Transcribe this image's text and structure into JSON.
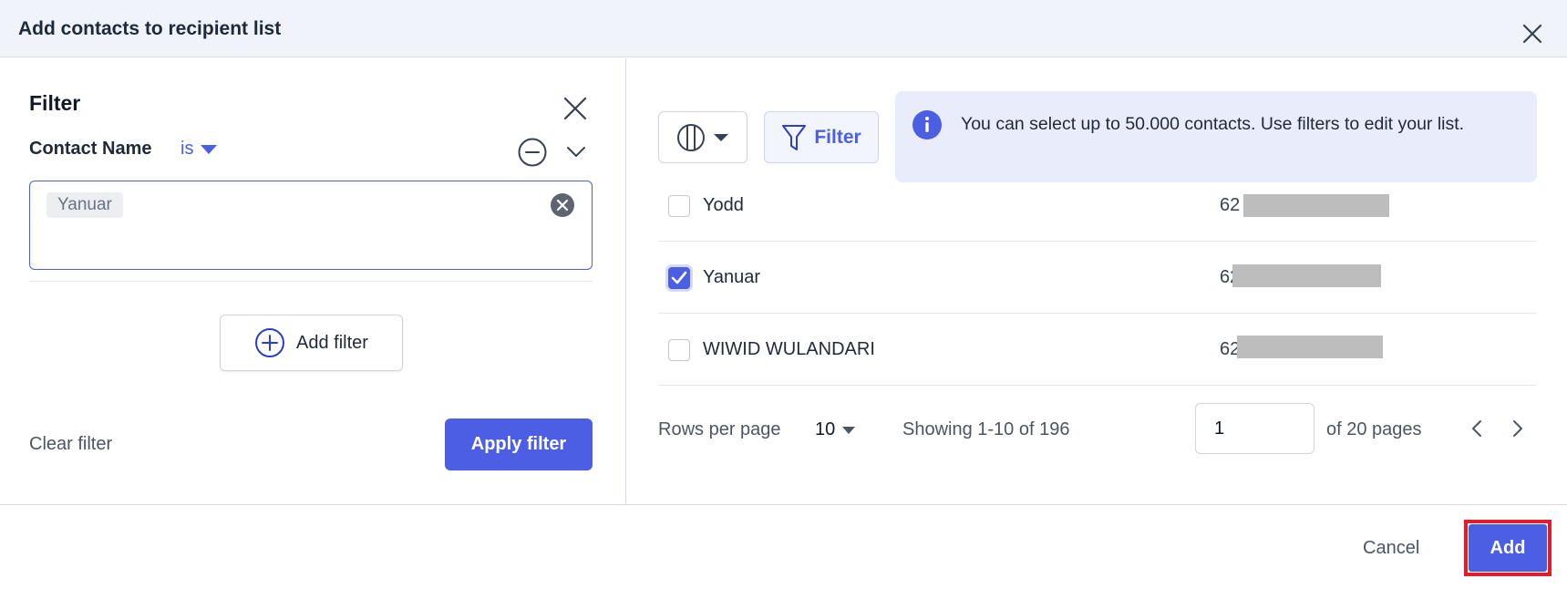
{
  "dialog": {
    "title": "Add contacts to recipient list"
  },
  "filter_panel": {
    "title": "Filter",
    "condition": {
      "field_label": "Contact Name",
      "operator": "is",
      "value_tag": "Yanuar"
    },
    "add_filter_label": "Add filter",
    "clear_filter_label": "Clear filter",
    "apply_filter_label": "Apply filter"
  },
  "toolbar": {
    "filter_label": "Filter",
    "info_message": "You can select up to 50.000 contacts. Use filters to edit your list."
  },
  "contacts": [
    {
      "name": "Yodd",
      "phone_prefix": "62",
      "checked": false
    },
    {
      "name": "Yanuar",
      "phone_prefix": "62",
      "checked": true
    },
    {
      "name": "WIWID WULANDARI",
      "phone_prefix": "62",
      "checked": false
    }
  ],
  "pagination": {
    "rows_per_page_label": "Rows per page",
    "rows_per_page_value": "10",
    "showing_text": "Showing 1-10 of 196",
    "page_value": "1",
    "of_pages_text": "of 20 pages"
  },
  "footer": {
    "cancel_label": "Cancel",
    "add_label": "Add"
  },
  "colors": {
    "accent": "#4b5ee4",
    "highlight_outline": "#e11d2b",
    "info_background": "#e9ecfb"
  }
}
